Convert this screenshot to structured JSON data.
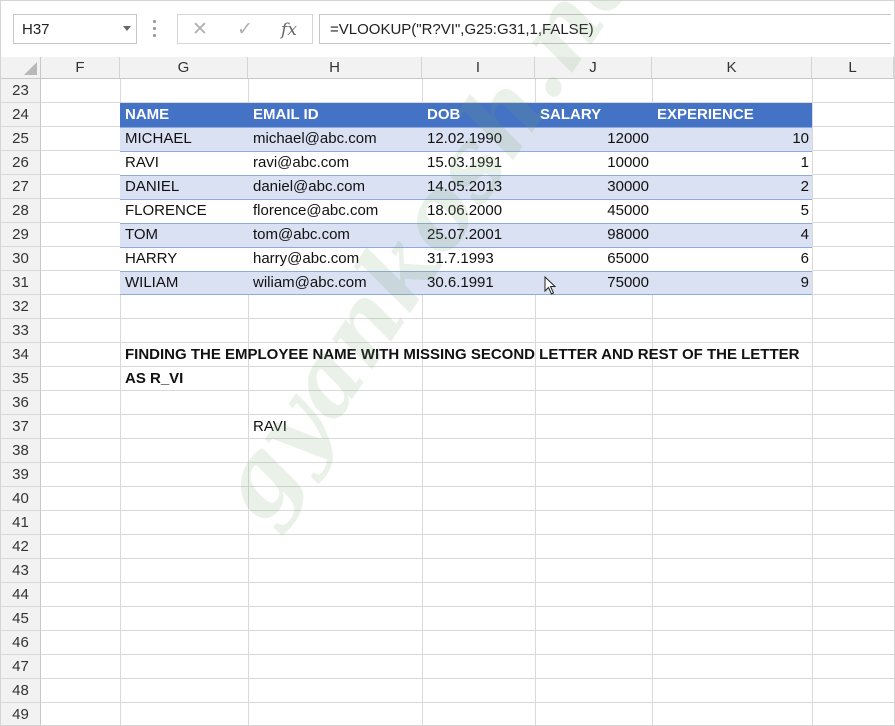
{
  "formula_bar": {
    "name_box": "H37",
    "cancel_icon": "✕",
    "enter_icon": "✓",
    "fx_label": "fx",
    "formula": "=VLOOKUP(\"R?VI\",G25:G31,1,FALSE)"
  },
  "columns": [
    "F",
    "G",
    "H",
    "I",
    "J",
    "K",
    "L"
  ],
  "rows": [
    "23",
    "24",
    "25",
    "26",
    "27",
    "28",
    "29",
    "30",
    "31",
    "32",
    "33",
    "34",
    "35",
    "36",
    "37",
    "38",
    "39",
    "40",
    "41",
    "42",
    "43",
    "44",
    "45",
    "46",
    "47",
    "48",
    "49"
  ],
  "table": {
    "headers": [
      "NAME",
      "EMAIL ID",
      "DOB",
      "SALARY",
      "EXPERIENCE"
    ],
    "rows": [
      [
        "MICHAEL",
        "michael@abc.com",
        "12.02.1990",
        "12000",
        "10"
      ],
      [
        "RAVI",
        "ravi@abc.com",
        "15.03.1991",
        "10000",
        "1"
      ],
      [
        "DANIEL",
        "daniel@abc.com",
        "14.05.2013",
        "30000",
        "2"
      ],
      [
        "FLORENCE",
        "florence@abc.com",
        "18.06.2000",
        "45000",
        "5"
      ],
      [
        "TOM",
        "tom@abc.com",
        "25.07.2001",
        "98000",
        "4"
      ],
      [
        "HARRY",
        "harry@abc.com",
        "31.7.1993",
        "65000",
        "6"
      ],
      [
        "WILIAM",
        "wiliam@abc.com",
        "30.6.1991",
        "75000",
        "9"
      ]
    ]
  },
  "note": {
    "line1": "FINDING THE EMPLOYEE NAME WITH MISSING SECOND LETTER AND REST OF THE LETTER",
    "line2": "AS R_VI"
  },
  "result": "RAVI",
  "watermark": "gyankosh.net",
  "colors": {
    "header_fill": "#4472c4",
    "band_fill": "#d9e1f2",
    "band_border": "#8ea9db",
    "watermark": "#78aa6e"
  }
}
